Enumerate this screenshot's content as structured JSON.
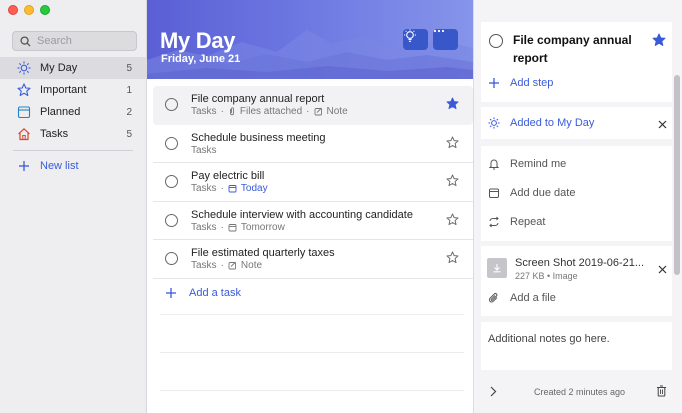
{
  "sidebar": {
    "search_placeholder": "Search",
    "items": [
      {
        "label": "My Day",
        "count": "5",
        "icon": "sun-icon",
        "active": true
      },
      {
        "label": "Important",
        "count": "1",
        "icon": "star-icon"
      },
      {
        "label": "Planned",
        "count": "2",
        "icon": "calendar-icon"
      },
      {
        "label": "Tasks",
        "count": "5",
        "icon": "home-icon"
      }
    ],
    "new_list_label": "New list"
  },
  "main": {
    "title": "My Day",
    "date": "Friday, June 21",
    "tasks": [
      {
        "title": "File company annual report",
        "list": "Tasks",
        "meta1": "Files attached",
        "meta2": "Note",
        "starred": true
      },
      {
        "title": "Schedule business meeting",
        "list": "Tasks",
        "starred": false
      },
      {
        "title": "Pay electric bill",
        "list": "Tasks",
        "due": "Today",
        "starred": false
      },
      {
        "title": "Schedule interview with accounting candidate",
        "list": "Tasks",
        "due": "Tomorrow",
        "starred": false
      },
      {
        "title": "File estimated quarterly taxes",
        "list": "Tasks",
        "meta2": "Note",
        "starred": false
      }
    ],
    "add_task_label": "Add a task"
  },
  "detail": {
    "title": "File company annual report",
    "add_step_label": "Add step",
    "added_to_my_day_label": "Added to My Day",
    "remind_me_label": "Remind me",
    "add_due_date_label": "Add due date",
    "repeat_label": "Repeat",
    "file": {
      "name": "Screen Shot 2019-06-21...",
      "meta": "227 KB • Image"
    },
    "add_file_label": "Add a file",
    "notes": "Additional notes go here.",
    "created": "Created 2 minutes ago"
  },
  "colors": {
    "accent": "#3a5bd9",
    "banner_start": "#5a5fd4",
    "banner_end": "#8694ea"
  }
}
